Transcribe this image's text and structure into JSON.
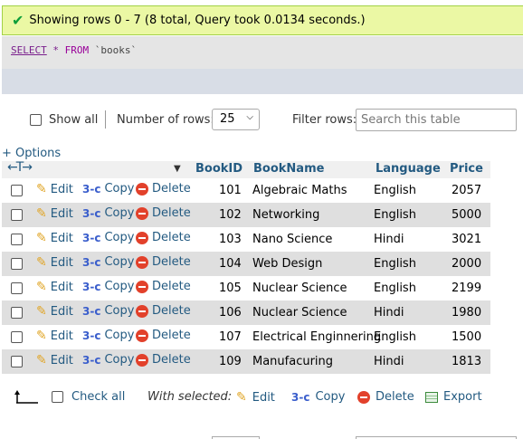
{
  "message": {
    "icon": "check-icon",
    "text": "Showing rows 0 - 7 (8 total, Query took 0.0134 seconds.)"
  },
  "query": {
    "select": "SELECT",
    "star": "*",
    "from": "FROM",
    "table": "`books`"
  },
  "nav": {
    "show_all": "Show all",
    "rows_label": "Number of rows:",
    "rows_value": "25",
    "filter_label": "Filter rows:",
    "filter_placeholder": "Search this table"
  },
  "options_label": "+ Options",
  "columns": [
    "BookID",
    "BookName",
    "Language",
    "Price"
  ],
  "actions": {
    "edit": "Edit",
    "copy": "Copy",
    "delete": "Delete"
  },
  "rows": [
    {
      "id": "101",
      "name": "Algebraic Maths",
      "language": "English",
      "price": "2057"
    },
    {
      "id": "102",
      "name": "Networking",
      "language": "English",
      "price": "5000"
    },
    {
      "id": "103",
      "name": "Nano Science",
      "language": "Hindi",
      "price": "3021"
    },
    {
      "id": "104",
      "name": "Web Design",
      "language": "English",
      "price": "2000"
    },
    {
      "id": "105",
      "name": "Nuclear Science",
      "language": "English",
      "price": "2199"
    },
    {
      "id": "106",
      "name": "Nuclear Science",
      "language": "Hindi",
      "price": "1980"
    },
    {
      "id": "107",
      "name": "Electrical Enginnering",
      "language": "English",
      "price": "1500"
    },
    {
      "id": "109",
      "name": "Manufacuring",
      "language": "Hindi",
      "price": "1813"
    }
  ],
  "bottom": {
    "check_all": "Check all",
    "with_selected": "With selected:",
    "edit": "Edit",
    "copy": "Copy",
    "delete": "Delete",
    "export": "Export"
  },
  "colors": {
    "success_bg": "#ebf8a4",
    "link": "#235a81",
    "row_alt": "#dfdfdf"
  }
}
